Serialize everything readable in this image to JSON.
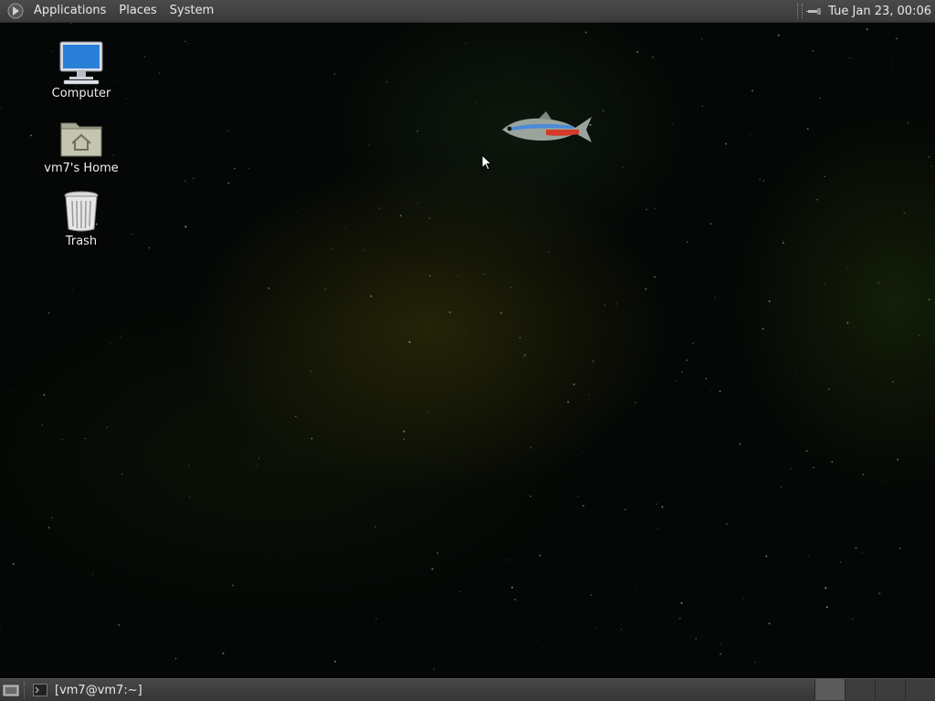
{
  "top_panel": {
    "menus": [
      {
        "label": "Applications"
      },
      {
        "label": "Places"
      },
      {
        "label": "System"
      }
    ],
    "clock": "Tue Jan 23, 00:06",
    "logo_icon": "gnome-foot-icon",
    "tray_icon": "network-icon"
  },
  "desktop": {
    "icons": [
      {
        "label": "Computer",
        "icon": "computer-icon"
      },
      {
        "label": "vm7's Home",
        "icon": "home-folder-icon"
      },
      {
        "label": "Trash",
        "icon": "trash-icon"
      }
    ]
  },
  "bottom_panel": {
    "show_desktop_icon": "show-desktop-icon",
    "tasks": [
      {
        "label": "[vm7@vm7:~]",
        "icon": "terminal-icon"
      }
    ],
    "workspaces": [
      {
        "active": true
      },
      {
        "active": false
      },
      {
        "active": false
      },
      {
        "active": false
      }
    ]
  },
  "colors": {
    "panel": "#3f3f3f",
    "desktop_bg": "#040705",
    "panel_text": "#e8e8e8"
  }
}
